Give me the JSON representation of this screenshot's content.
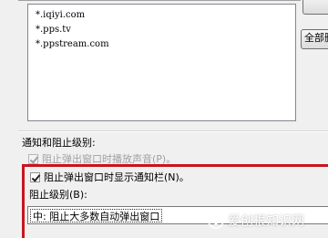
{
  "site_list": {
    "items": [
      "*.iqiyi.com",
      "*.pps.tv",
      "*.ppstream.com"
    ]
  },
  "buttons": {
    "clipped_top_label": "",
    "clear_all_label": "全部删"
  },
  "notify_section": {
    "title": "通知和阻止级别:",
    "play_sound_label": "阻止弹出窗口时播放声音(P)。",
    "play_sound_checked": true,
    "show_notify_bar_label": "阻止弹出窗口时显示通知栏(N)。",
    "show_notify_bar_checked": true,
    "block_level_label": "阻止级别(B):",
    "block_level_value": "中: 阻止大多数自动弹出窗口"
  },
  "watermark": {
    "text": "爱创根知识网"
  },
  "colors": {
    "highlight": "#c8141e",
    "dialog_bg": "#f0f0f0"
  }
}
